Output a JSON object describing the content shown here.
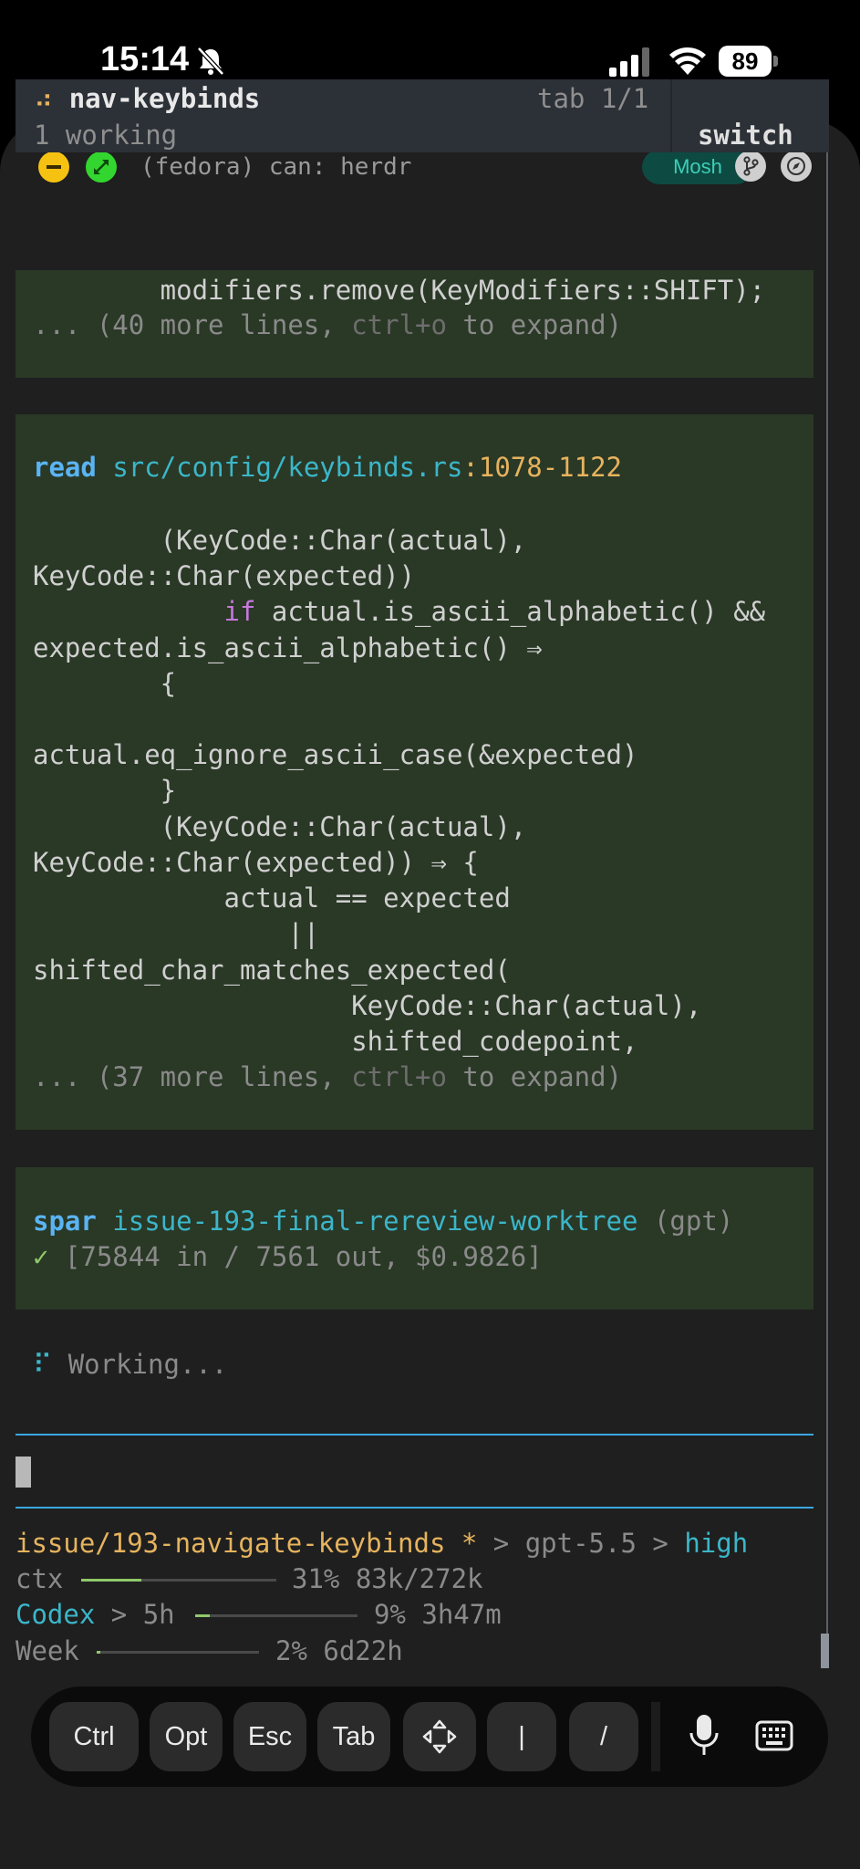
{
  "status_bar": {
    "time": "15:14",
    "battery": "89",
    "icons": [
      "bell-slash-icon",
      "cellular-signal-icon",
      "wifi-icon",
      "battery-icon"
    ]
  },
  "window": {
    "title": "(fedora) can: herdr",
    "mosh_badge": "Mosh",
    "icons": [
      "minimize-icon",
      "expand-icon",
      "git-branch-icon",
      "compass-icon"
    ],
    "colors": {
      "min": "#f5c211",
      "max": "#33d62f",
      "mosh_bg": "#0d4a42",
      "mosh_fg": "#3ccfb8"
    }
  },
  "tab": {
    "spinner": "⠴",
    "name": "nav-keybinds",
    "count": "tab 1/1",
    "working": "1 working",
    "switch": "switch"
  },
  "blocks": {
    "first": {
      "line1": "        modifiers.remove(KeyModifiers::SHIFT);",
      "more_prefix": "... (40 more lines, ",
      "more_key": "ctrl+o",
      "more_suffix": " to expand)"
    },
    "read": {
      "cmd": "read",
      "path": "src/config/keybinds.rs",
      "range": ":1078-1122",
      "code": [
        "        (KeyCode::Char(actual),",
        "KeyCode::Char(expected))",
        "expected.is_ascii_alphabetic() ⇒",
        "        {",
        "",
        "actual.eq_ignore_ascii_case(&expected)",
        "        }",
        "        (KeyCode::Char(actual),",
        "KeyCode::Char(expected)) ⇒ {",
        "            actual == expected",
        "                ||",
        "shifted_char_matches_expected(",
        "                    KeyCode::Char(actual),",
        "                    shifted_codepoint,"
      ],
      "if_indent": "            ",
      "if_kw": "if",
      "if_rest": " actual.is_ascii_alphabetic() &&",
      "more_prefix": "... (37 more lines, ",
      "more_key": "ctrl+o",
      "more_suffix": " to expand)"
    },
    "spar": {
      "cmd": "spar",
      "name": "issue-193-final-rereview-worktree",
      "model": " (gpt)",
      "check": "✓",
      "stats": " [75844 in / 7561 out, $0.9826]"
    }
  },
  "working": {
    "spinner": "⠏",
    "text": "Working..."
  },
  "statusline": {
    "branch": "issue/193-navigate-keybinds",
    "dirty": " *",
    "sep1": " > ",
    "model": "gpt-5.5",
    "sep2": " > ",
    "effort": "high",
    "ctx_label": "ctx",
    "ctx_pct": 0.31,
    "ctx_value": "31% 83k/272k",
    "codex_label": "Codex",
    "codex_window": " > 5h",
    "codex_pct": 0.09,
    "codex_value": "9% 3h47m",
    "week_label": "Week",
    "week_pct": 0.02,
    "week_value": "2% 6d22h"
  },
  "toolbar": {
    "keys": [
      "Ctrl",
      "Opt",
      "Esc",
      "Tab",
      "|",
      "/"
    ],
    "icons": [
      "move-arrows-icon",
      "microphone-icon",
      "keyboard-icon"
    ]
  }
}
